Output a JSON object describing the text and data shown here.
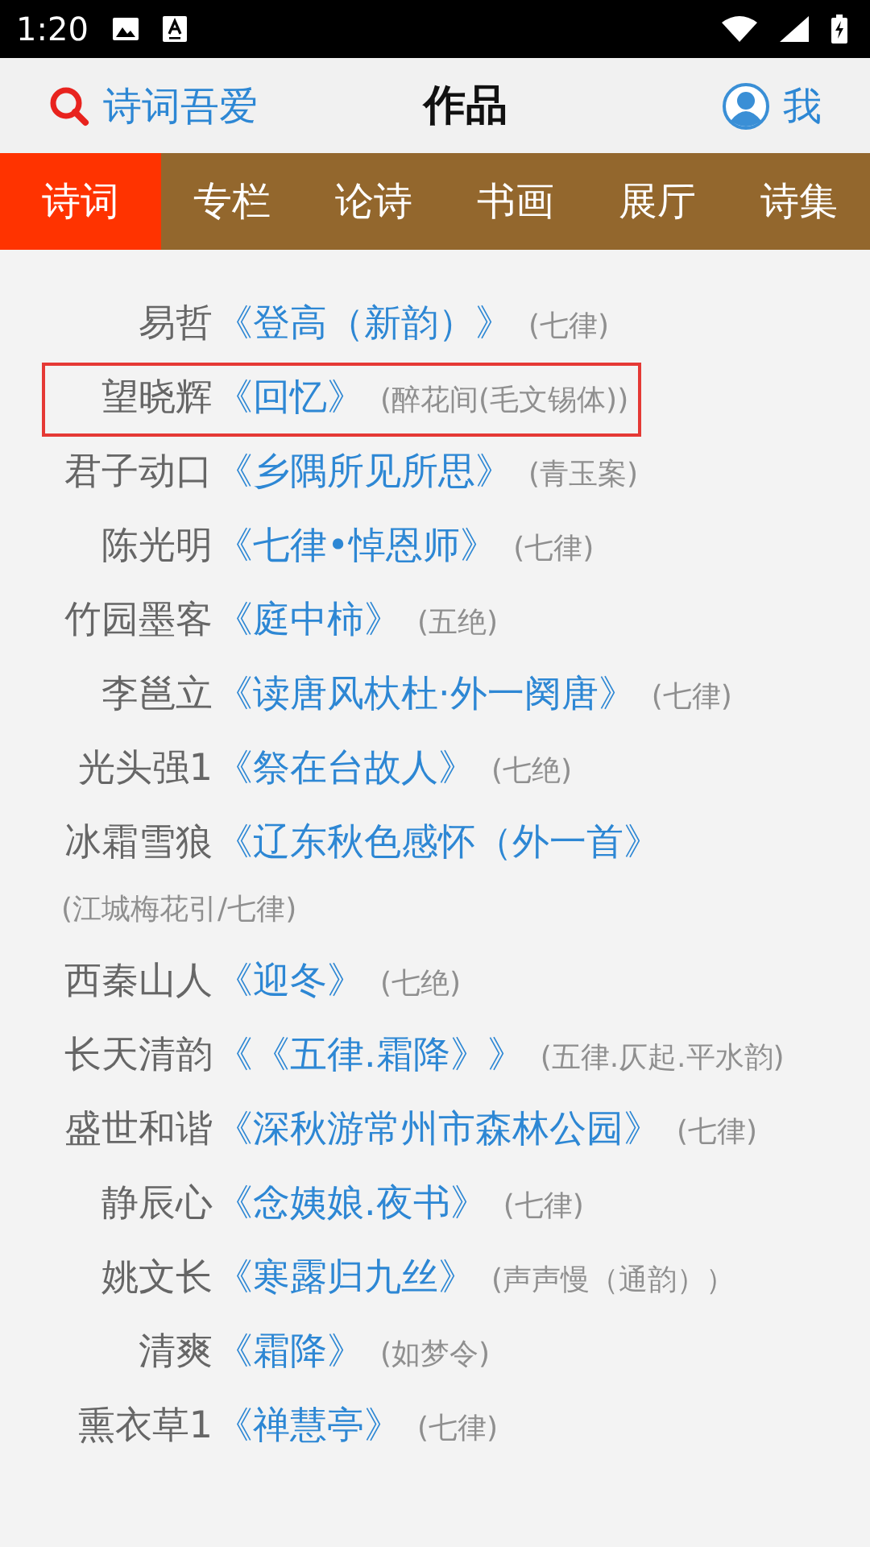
{
  "status_bar": {
    "time": "1:20"
  },
  "header": {
    "search_label": "诗词吾爱",
    "title": "作品",
    "profile_label": "我"
  },
  "tabs": [
    {
      "label": "诗词",
      "selected": true
    },
    {
      "label": "专栏",
      "selected": false
    },
    {
      "label": "论诗",
      "selected": false
    },
    {
      "label": "书画",
      "selected": false
    },
    {
      "label": "展厅",
      "selected": false
    },
    {
      "label": "诗集",
      "selected": false
    }
  ],
  "works": [
    {
      "author": "易哲",
      "title": "《登高（新韵）》",
      "form": "(七律)",
      "highlighted": false
    },
    {
      "author": "望晓辉",
      "title": "《回忆》",
      "form": "(醉花间(毛文锡体))",
      "highlighted": true
    },
    {
      "author": "君子动口",
      "title": "《乡隅所见所思》",
      "form": "(青玉案)",
      "highlighted": false
    },
    {
      "author": "陈光明",
      "title": "《七律•悼恩师》",
      "form": "(七律)",
      "highlighted": false
    },
    {
      "author": "竹园墨客",
      "title": "《庭中柿》",
      "form": "(五绝)",
      "highlighted": false
    },
    {
      "author": "李邕立",
      "title": "《读唐风杕杜·外一阕唐》",
      "form": "(七律)",
      "highlighted": false
    },
    {
      "author": "光头强1",
      "title": "《祭在台故人》",
      "form": "(七绝)",
      "highlighted": false
    },
    {
      "author": "冰霜雪狼",
      "title": "《辽东秋色感怀（外一首》",
      "form": "(江城梅花引/七律)",
      "highlighted": false
    },
    {
      "author": "西秦山人",
      "title": "《迎冬》",
      "form": "(七绝)",
      "highlighted": false
    },
    {
      "author": "长天清韵",
      "title": "《《五律.霜降》》",
      "form": "(五律.仄起.平水韵)",
      "highlighted": false
    },
    {
      "author": "盛世和谐",
      "title": "《深秋游常州市森林公园》",
      "form": "(七律)",
      "highlighted": false
    },
    {
      "author": "静辰心",
      "title": "《念姨娘.夜书》",
      "form": "(七律)",
      "highlighted": false
    },
    {
      "author": "姚文长",
      "title": "《寒露归九丝》",
      "form": "(声声慢（通韵））",
      "highlighted": false
    },
    {
      "author": "清爽",
      "title": "《霜降》",
      "form": "(如梦令)",
      "highlighted": false
    },
    {
      "author": "熏衣草1",
      "title": "《禅慧亭》",
      "form": "(七律)",
      "highlighted": false
    }
  ]
}
